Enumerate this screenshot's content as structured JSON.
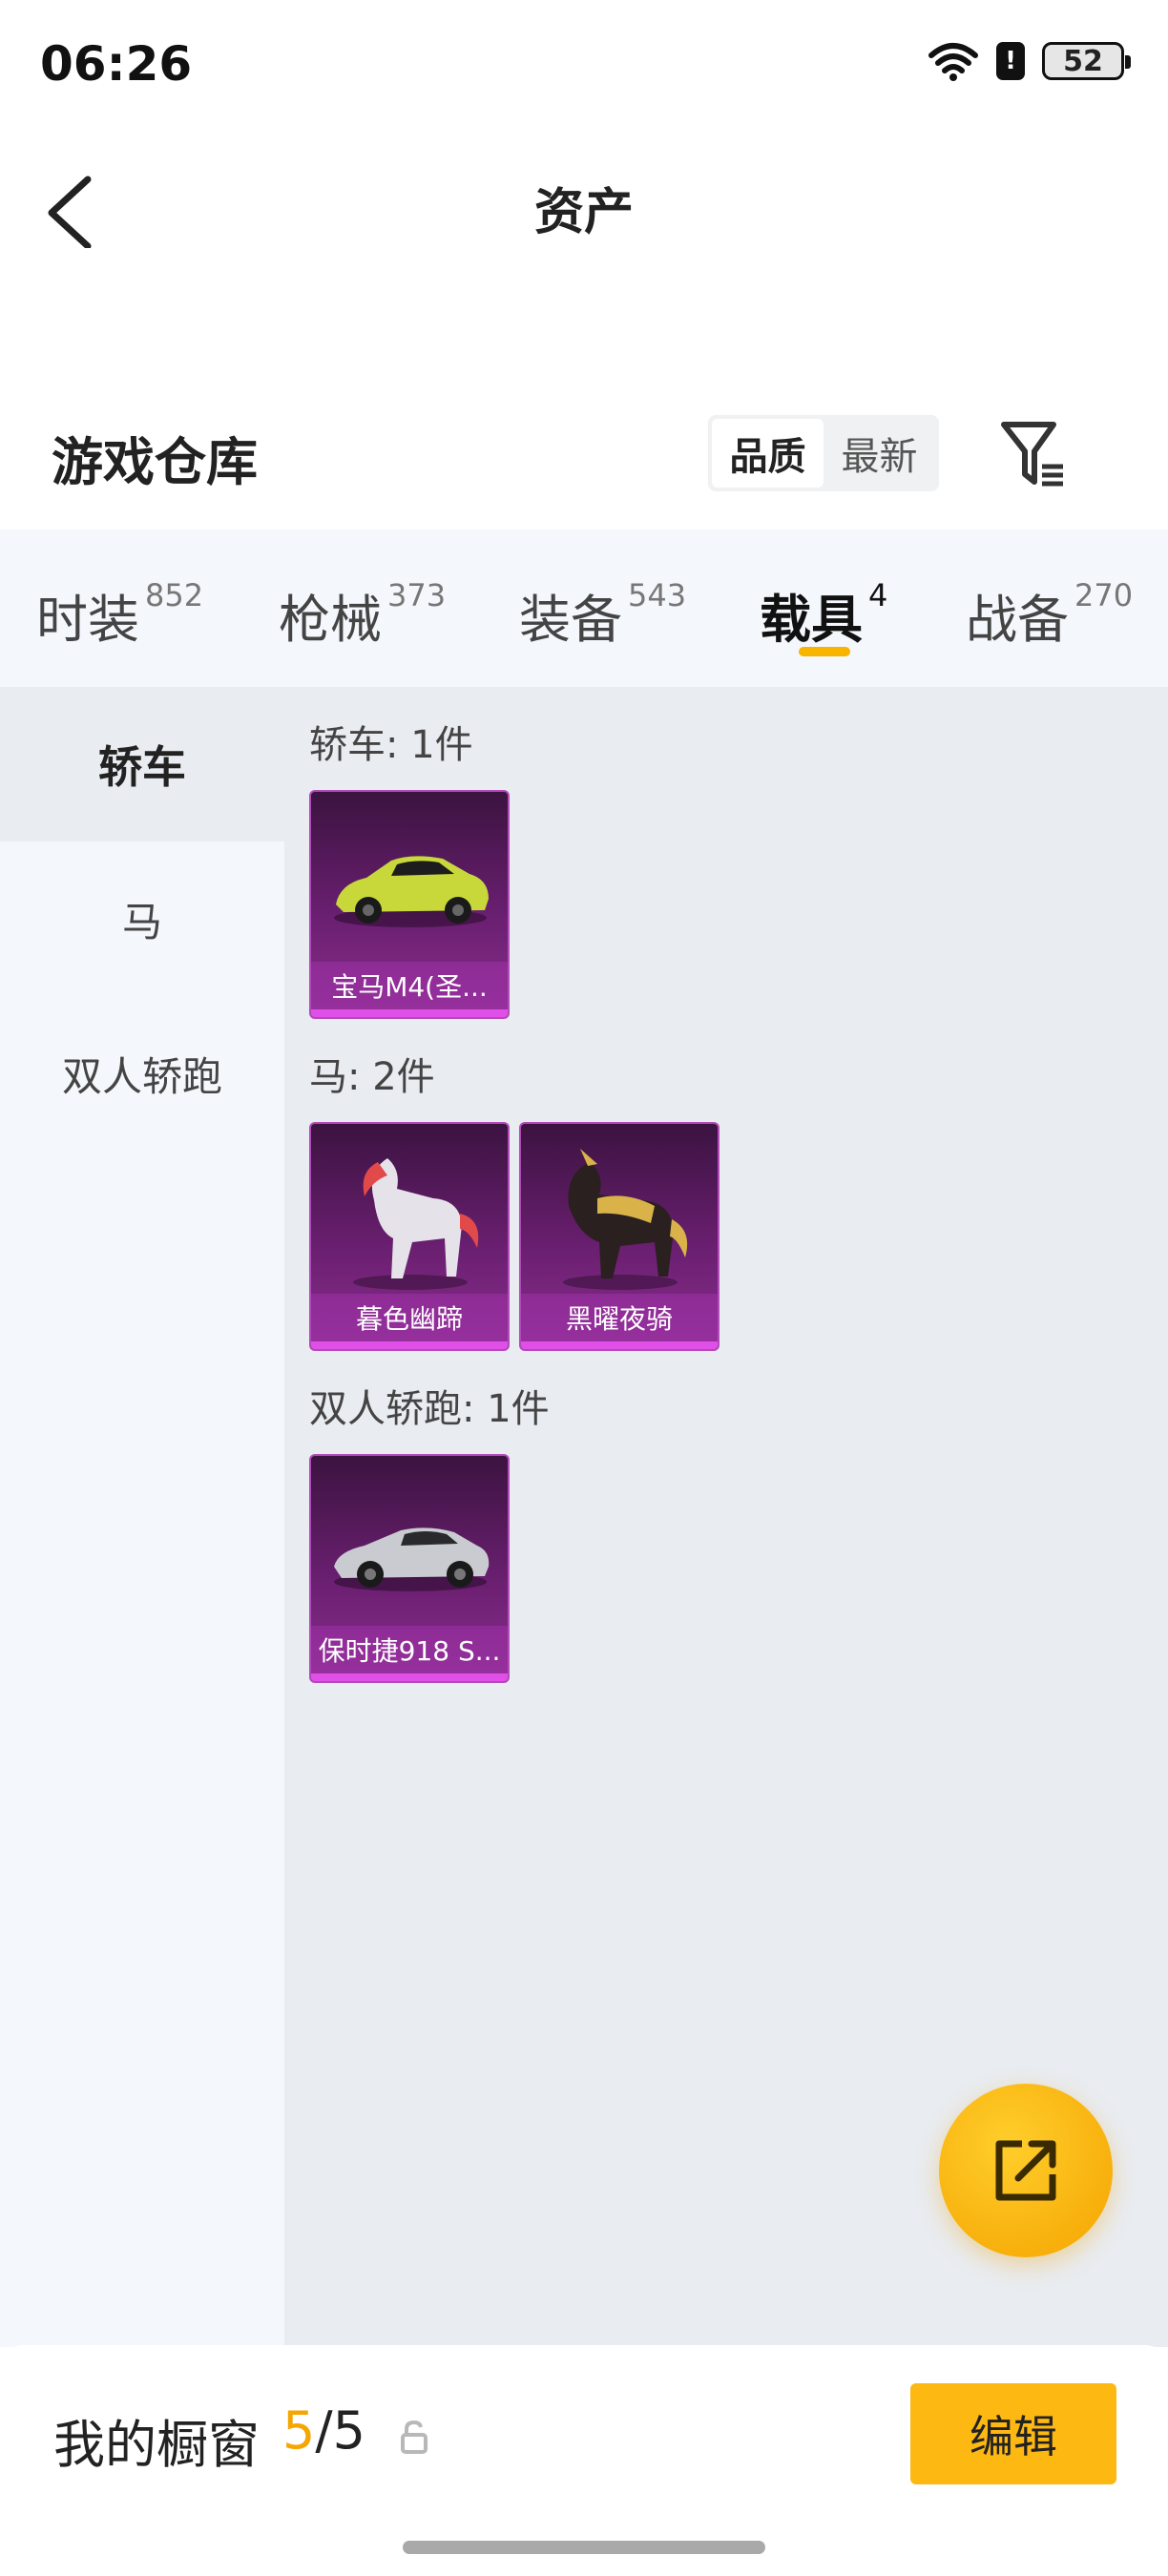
{
  "status_bar": {
    "time": "06:26",
    "battery": "52"
  },
  "header": {
    "title": "资产"
  },
  "warehouse": {
    "title": "游戏仓库",
    "sort_options": [
      "品质",
      "最新"
    ],
    "active_sort": "品质"
  },
  "tabs": [
    {
      "label": "时装",
      "count": "852"
    },
    {
      "label": "枪械",
      "count": "373"
    },
    {
      "label": "装备",
      "count": "543"
    },
    {
      "label": "载具",
      "count": "4",
      "active": true
    },
    {
      "label": "战备",
      "count": "270"
    }
  ],
  "sidebar": {
    "items": [
      "轿车",
      "马",
      "双人轿跑"
    ],
    "active": "轿车"
  },
  "groups": [
    {
      "title": "轿车: 1件",
      "items": [
        {
          "name": "宝马M4(圣...",
          "icon": "car-icon"
        }
      ]
    },
    {
      "title": "马: 2件",
      "items": [
        {
          "name": "暮色幽蹄",
          "icon": "horse-icon"
        },
        {
          "name": "黑曜夜骑",
          "icon": "horse-icon"
        }
      ]
    },
    {
      "title": "双人轿跑: 1件",
      "items": [
        {
          "name": "保时捷918 S...",
          "icon": "car-icon"
        }
      ]
    }
  ],
  "showcase": {
    "label": "我的橱窗",
    "current": "5",
    "total": "5"
  },
  "actions": {
    "edit_label": "编辑"
  },
  "colors": {
    "accent": "#f8b500",
    "card_purple": "#6a1f70"
  }
}
